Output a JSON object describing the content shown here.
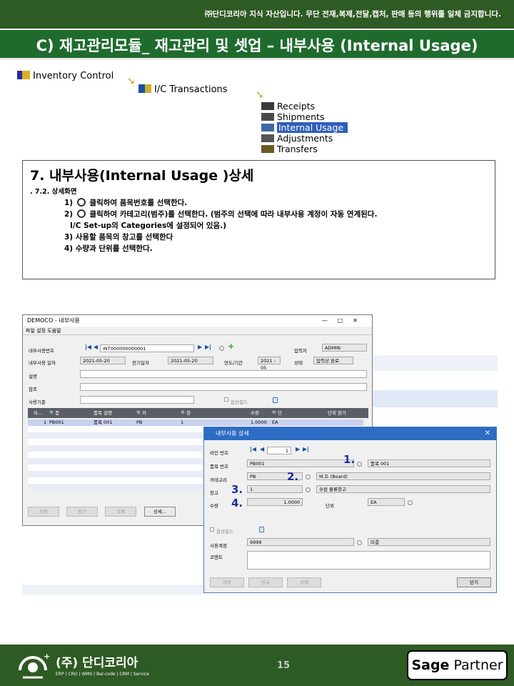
{
  "header": {
    "notice": "㈜단디코리아 지식 자산입니다. 무단 전재,복제,전달,캡처, 판매 등의 행위를 일체 금지합니다.",
    "title": "C) 재고관리모듈_ 재고관리 및 셋업 – 내부사용 (Internal Usage)"
  },
  "nav": {
    "level1": "Inventory Control",
    "level2": "I/C Transactions",
    "items": [
      "Receipts",
      "Shipments",
      "Internal Usage",
      "Adjustments",
      "Transfers"
    ],
    "selected": "Internal Usage"
  },
  "description": {
    "heading": "7. 내부사용(Internal Usage )상세",
    "subheading": ". 7.2. 상세화면",
    "step1_num": "1)",
    "step1": "클릭하여 품목번호를 선택한다.",
    "step2_num": "2)",
    "step2": "클릭하여 카테고리(범주)를  선택한다. (범주의 선택에 따라 내부사용 계정이 자동 연계된다.",
    "step2b": "I/C Set-up의 Categories에 설정되어 있음.)",
    "step3": "3) 사용할 품목의 창고를 선택한다",
    "step4": "4) 수량과 단위를 선택한다."
  },
  "main_window": {
    "title": "DEMOCO - 내부사용",
    "menu": "파일  설정  도움말",
    "labels": {
      "doc_no": "내부사용번호",
      "date": "내부사용 일자",
      "post_date": "전기일자",
      "year_period": "연도/기간",
      "status": "상태",
      "entered_by": "입력자",
      "description": "설명",
      "reference": "참조",
      "expense_basis": "사용기준",
      "optional_fields": "옵션필드"
    },
    "values": {
      "doc_no": "INT000000000001",
      "date": "2021-05-20",
      "post_date": "2021-05-20",
      "year_period": "2021 - 05",
      "status": "입력상 완료",
      "entered_by": "ADMIN"
    },
    "columns": [
      "라...",
      "품목 번호",
      "품목 설명",
      "카테고리",
      "창고",
      "수량",
      "단위",
      "단위 원가"
    ],
    "row": [
      "1",
      "PB001",
      "품목 001",
      "PB",
      "1",
      "1.0000",
      "EA",
      ""
    ],
    "buttons": [
      "저장",
      "전기",
      "삭제",
      "상세..."
    ]
  },
  "detail_dialog": {
    "title": "내부사용 상세",
    "labels": {
      "line_no": "라인 번호",
      "item_no": "품목 번호",
      "category": "카테고리",
      "location": "창고",
      "quantity": "수량",
      "unit": "단위",
      "optional": "옵션필드",
      "account": "사용계정",
      "comment": "코멘트"
    },
    "values": {
      "line_no": "1",
      "item_no": "PB001",
      "item_desc": "품목 001",
      "category": "PB",
      "category_desc": "M.트 (Board)",
      "location": "1",
      "location_desc": "수원 물류창고",
      "quantity": "1.0000",
      "unit": "EA",
      "account": "9999",
      "account_desc": "미결"
    },
    "callouts": [
      "1.",
      "2.",
      "3.",
      "4."
    ],
    "buttons": [
      "저장",
      "신규",
      "삭제",
      "닫기"
    ]
  },
  "footer": {
    "company": "(주) 단디코리아",
    "tagline": "ERP | CRO | WMS | Bar-code | CRM | Service",
    "page": "15",
    "partner_brand": "Sage",
    "partner_label": "Partner"
  },
  "colors": {
    "header_green": "#2e5a23",
    "title_green": "#1f6b2e",
    "dialog_blue": "#2d6cc4",
    "callout_blue": "#1a2fa0"
  }
}
